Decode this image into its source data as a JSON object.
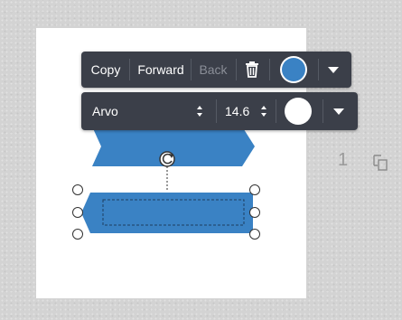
{
  "toolbar": {
    "copy_label": "Copy",
    "forward_label": "Forward",
    "back_label": "Back",
    "delete_icon": "trash-icon",
    "fill_color": "#3a82c4",
    "dropdown_icon": "chevron-down-icon"
  },
  "text_toolbar": {
    "font_family": "Arvo",
    "font_size": "14.6",
    "text_color": "#ffffff",
    "dropdown_icon": "chevron-down-icon"
  },
  "canvas": {
    "shape_color": "#3a82c4",
    "rotate_icon": "rotate-icon",
    "page_number": "1",
    "duplicate_icon": "duplicate-page-icon"
  }
}
